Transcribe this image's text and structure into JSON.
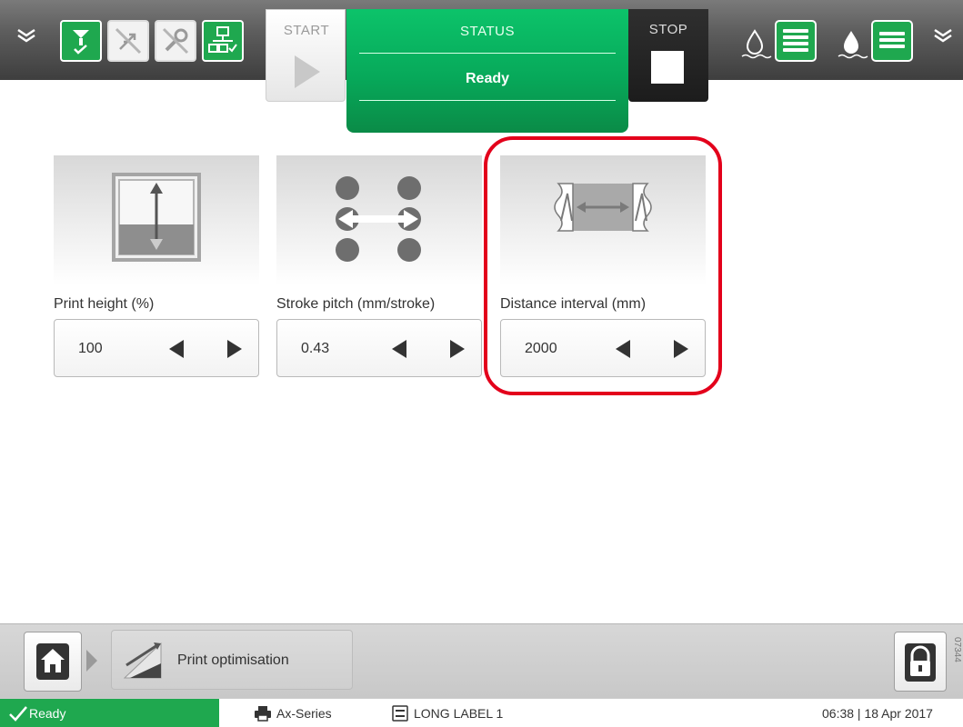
{
  "topbar": {
    "start_label": "START",
    "status_label": "STATUS",
    "status_value": "Ready",
    "stop_label": "STOP",
    "status_icons": [
      "message-status-icon",
      "usb-disabled-icon",
      "tool-disabled-icon",
      "network-icon"
    ],
    "ink_icons": [
      "ink-drop-icon",
      "ink-level-icon",
      "makeup-drop-icon",
      "makeup-level-icon"
    ]
  },
  "params": [
    {
      "label": "Print height (%)",
      "value": "100",
      "icon": "print-height-icon"
    },
    {
      "label": "Stroke pitch (mm/stroke)",
      "value": "0.43",
      "icon": "stroke-pitch-icon"
    },
    {
      "label": "Distance interval (mm)",
      "value": "2000",
      "icon": "distance-interval-icon"
    }
  ],
  "nav": {
    "breadcrumb_label": "Print optimisation",
    "side_code": "07344"
  },
  "statusbar": {
    "state": "Ready",
    "printer": "Ax-Series",
    "job": "LONG LABEL 1",
    "datetime": "06:38 | 18 Apr 2017"
  },
  "colors": {
    "accent_green": "#1fa84f",
    "status_green": "#07a95a",
    "highlight_red": "#e3001b"
  }
}
